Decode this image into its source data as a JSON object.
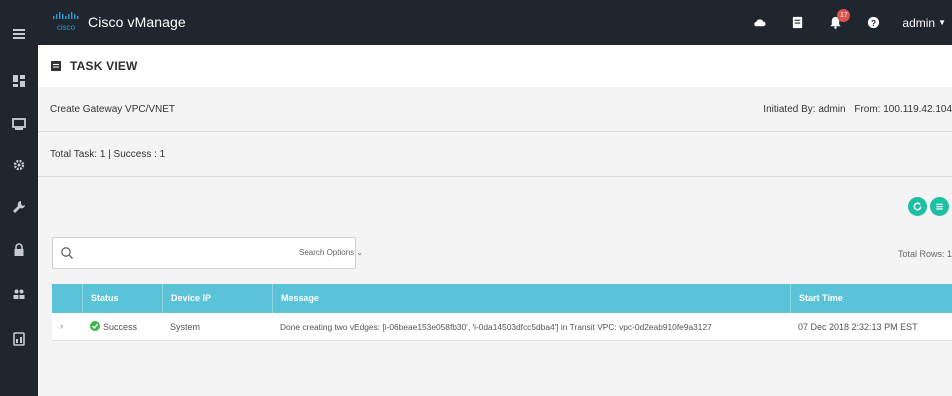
{
  "app": {
    "logo_label": "cisco",
    "title": "Cisco vManage",
    "user": "admin",
    "alarm_count": "17"
  },
  "colors": {
    "topbar": "#20262e",
    "accent": "#1ebfa5",
    "table_header": "#5bc3d8",
    "success": "#3cb54a",
    "alarm": "#d9534f"
  },
  "sidebar": {
    "items": [
      {
        "icon": "menu-icon"
      },
      {
        "icon": "dashboard-icon"
      },
      {
        "icon": "monitor-icon"
      },
      {
        "icon": "gear-icon"
      },
      {
        "icon": "wrench-icon"
      },
      {
        "icon": "lock-icon"
      },
      {
        "icon": "users-icon"
      },
      {
        "icon": "analytics-icon"
      }
    ]
  },
  "topbar_icons": [
    "cloud-icon",
    "task-list-icon",
    "bell-icon",
    "help-icon"
  ],
  "page": {
    "section_title": "TASK VIEW",
    "task_name": "Create Gateway VPC/VNET",
    "initiated_by": "Initiated By: admin",
    "from": "From: 100.119.42.104",
    "summary": "Total Task: 1 | Success : 1",
    "total_rows": "Total Rows: 1"
  },
  "search": {
    "placeholder": "",
    "value": "",
    "options_label": "Search Options"
  },
  "table": {
    "columns": [
      "Status",
      "Device IP",
      "Message",
      "Start Time"
    ],
    "rows": [
      {
        "status": "Success",
        "device_ip": "System",
        "message": "Done creating two vEdges: [i-06beae153e058fb30', 'i-0da14503dfcc5dba4'] in Transit VPC: vpc-0d2eab910fe9a3127",
        "start_time": "07 Dec 2018 2:32:13 PM EST"
      }
    ]
  }
}
